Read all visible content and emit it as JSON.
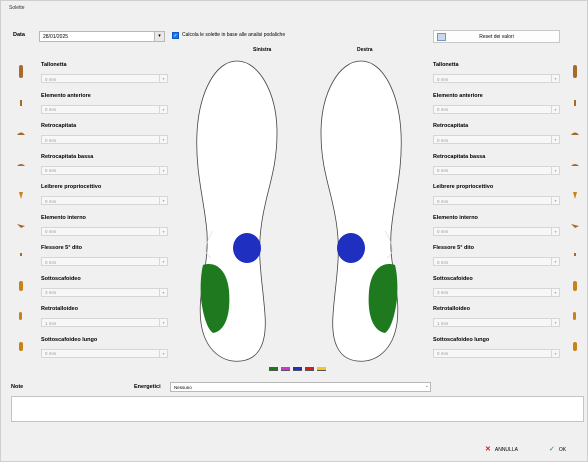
{
  "window": {
    "title": "Solette"
  },
  "top": {
    "date_label": "Data",
    "date_value": "28/01/2025",
    "date_button": "▾",
    "checkbox_label": "Calcola le solette in base alle analisi podaliche",
    "checkbox_checked": true,
    "reset_label": "Reset dei valori"
  },
  "headers": {
    "left": "Sinistra",
    "right": "Destra"
  },
  "left_fields": [
    {
      "label": "Tallonetta",
      "value": "0 mm"
    },
    {
      "label": "Elemento anteriore",
      "value": "0 mm"
    },
    {
      "label": "Retrocapitata",
      "value": "0 mm"
    },
    {
      "label": "Retrocapitata bassa",
      "value": "0 mm"
    },
    {
      "label": "Leibrere propriocettivo",
      "value": "0 mm"
    },
    {
      "label": "Elemento interno",
      "value": "0 mm"
    },
    {
      "label": "Flessore 5° dito",
      "value": "0 mm"
    },
    {
      "label": "Sottoscafoideo",
      "value": "3 mm"
    },
    {
      "label": "Retrotalloideo",
      "value": "1 mm"
    },
    {
      "label": "Sottoscafoideo lungo",
      "value": "0 mm"
    }
  ],
  "right_fields": [
    {
      "label": "Tallonetta",
      "value": "0 mm"
    },
    {
      "label": "Elemento anteriore",
      "value": "0 mm"
    },
    {
      "label": "Retrocapitata",
      "value": "0 mm"
    },
    {
      "label": "Retrocapitata bassa",
      "value": "0 mm"
    },
    {
      "label": "Leibrere propriocettivo",
      "value": "0 mm"
    },
    {
      "label": "Elemento interno",
      "value": "0 mm"
    },
    {
      "label": "Flessore 5° dito",
      "value": "0 mm"
    },
    {
      "label": "Sottoscafoideo",
      "value": "3 mm"
    },
    {
      "label": "Retrotalloideo",
      "value": "1 mm"
    },
    {
      "label": "Sottoscafoideo lungo",
      "value": "0 mm"
    }
  ],
  "legend_colors": [
    "#1a7a1a",
    "#d62fd6",
    "#1f2fbf",
    "#d22020",
    "#f2c81a"
  ],
  "soles": {
    "blue": "#1f2fbf",
    "green": "#1f7a1f"
  },
  "bottom": {
    "note_label": "Note",
    "energetici_label": "Energetici",
    "energetici_value": "Nessuno",
    "cancel_label": "ANNULLA",
    "ok_label": "OK"
  }
}
